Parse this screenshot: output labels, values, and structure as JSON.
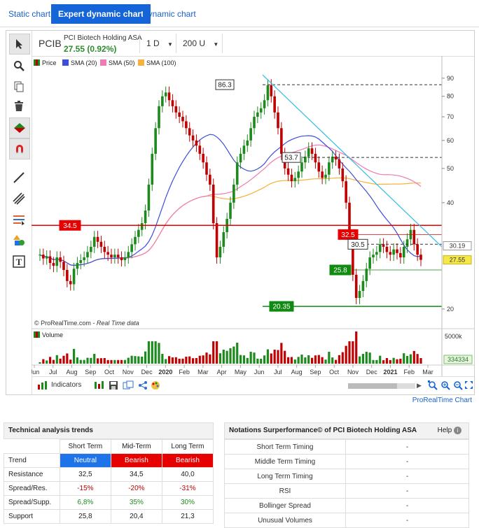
{
  "tabs": [
    "Static chart",
    "Expert dynamic chart",
    "Dynamic chart"
  ],
  "instrument": {
    "symbol": "PCIB",
    "name": "PCI Biotech Holding ASA",
    "price": "27.55 (0.92%)",
    "interval": "1 D",
    "units": "200 U"
  },
  "legend": [
    "Price",
    "SMA (20)",
    "SMA (50)",
    "SMA (100)"
  ],
  "colors": {
    "price_up": "#1d8a1d",
    "price_down": "#c00000",
    "sma20": "#3b4fd8",
    "sma50": "#f07ab4",
    "sma100": "#f5b23c",
    "trend": "#33bde6",
    "resistance": "#e60000",
    "support": "#118a11",
    "accent": "#1565d8"
  },
  "chart_data": {
    "type": "line",
    "title": "",
    "x_labels": [
      "Jun",
      "Jul",
      "Aug",
      "Sep",
      "Oct",
      "Nov",
      "Dec",
      "2020",
      "Feb",
      "Mar",
      "Apr",
      "May",
      "Jun",
      "Jul",
      "Aug",
      "Sep",
      "Oct",
      "Nov",
      "Dec",
      "2021",
      "Feb",
      "Mar"
    ],
    "y_ticks": [
      "90",
      "80",
      "70",
      "60",
      "50",
      "40",
      "20"
    ],
    "price_axis_labels": [
      "30.19",
      "27.55"
    ],
    "scale": "log",
    "y_range": [
      18,
      95
    ],
    "close_series": [
      28.5,
      27.8,
      28.2,
      27.0,
      26.5,
      28.0,
      27.2,
      25.8,
      24.0,
      23.5,
      26.0,
      27.0,
      27.5,
      28.0,
      29.0,
      30.0,
      32.0,
      31.0,
      30.0,
      29.0,
      28.5,
      28.0,
      28.5,
      28.0,
      27.5,
      28.0,
      29.0,
      30.5,
      32.0,
      33.5,
      35.0,
      38.0,
      45.0,
      55.0,
      65.0,
      75.0,
      80.0,
      82.0,
      78.0,
      75.0,
      72.0,
      70.0,
      68.0,
      65.0,
      62.0,
      60.0,
      58.0,
      55.0,
      52.0,
      48.0,
      45.0,
      35.0,
      28.0,
      30.0,
      33.0,
      36.0,
      40.0,
      45.0,
      52.0,
      55.0,
      58.0,
      60.0,
      65.0,
      70.0,
      72.0,
      74.0,
      78.0,
      86.0,
      80.0,
      72.0,
      65.0,
      55.0,
      50.0,
      48.0,
      46.0,
      47.0,
      49.0,
      52.0,
      54.0,
      57.0,
      55.0,
      52.0,
      49.0,
      47.0,
      48.0,
      52.0,
      54.0,
      53.0,
      50.0,
      46.0,
      40.0,
      32.0,
      25.0,
      21.5,
      22.5,
      24.0,
      26.0,
      28.0,
      28.5,
      29.0,
      30.5,
      30.0,
      29.0,
      28.5,
      29.5,
      28.8,
      28.0,
      30.0,
      31.5,
      33.5,
      30.5,
      28.5,
      27.55
    ],
    "volume_axis": "5000k",
    "last_volume": "334334",
    "annotations": [
      "86.3",
      "53.7",
      "34.5",
      "32.5",
      "30.5",
      "25.8",
      "20.35"
    ]
  },
  "watermark": "© ProRealTime.com",
  "realtime": "- Real Time data",
  "volume_label": "Volume",
  "indicators_label": "Indicators",
  "prt_link": "ProRealTime Chart",
  "trends": {
    "title": "Technical analysis trends",
    "headers": [
      "Short Term",
      "Mid-Term",
      "Long Term"
    ],
    "rows": [
      {
        "label": "Trend",
        "values": [
          "Neutral",
          "Bearish",
          "Bearish"
        ]
      },
      {
        "label": "Resistance",
        "values": [
          "32,5",
          "34,5",
          "40,0"
        ]
      },
      {
        "label": "Spread/Res.",
        "values": [
          "-15%",
          "-20%",
          "-31%"
        ]
      },
      {
        "label": "Spread/Supp.",
        "values": [
          "6,8%",
          "35%",
          "30%"
        ]
      },
      {
        "label": "Support",
        "values": [
          "25,8",
          "20,4",
          "21,3"
        ]
      }
    ]
  },
  "notations": {
    "title": "Notations Surperformance© of PCI Biotech Holding ASA",
    "help": "Help",
    "rows": [
      {
        "label": "Short Term Timing",
        "value": "-"
      },
      {
        "label": "Middle Term Timing",
        "value": "-"
      },
      {
        "label": "Long Term Timing",
        "value": "-"
      },
      {
        "label": "RSI",
        "value": "-"
      },
      {
        "label": "Bollinger Spread",
        "value": "-"
      },
      {
        "label": "Unusual Volumes",
        "value": "-"
      }
    ]
  }
}
